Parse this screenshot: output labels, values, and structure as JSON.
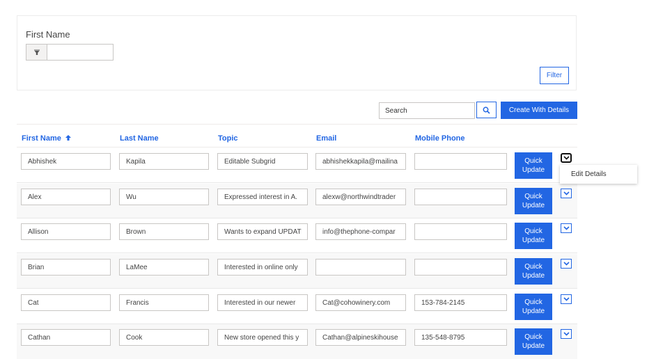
{
  "filter": {
    "label": "First Name",
    "value": "",
    "filter_button": "Filter"
  },
  "toolbar": {
    "search_placeholder": "Search",
    "create_button": "Create With Details"
  },
  "columns": [
    "First Name",
    "Last Name",
    "Topic",
    "Email",
    "Mobile Phone"
  ],
  "sort": {
    "column": "First Name",
    "direction": "ascending"
  },
  "rows": [
    {
      "first": "Abhishek",
      "last": "Kapila",
      "topic": "Editable Subgrid",
      "email": "abhishekkapila@mailina",
      "phone": "",
      "button": "Quick Update"
    },
    {
      "first": "Alex",
      "last": "Wu",
      "topic": "Expressed interest in A.",
      "email": "alexw@northwindtrader",
      "phone": "",
      "button": "Quick Update"
    },
    {
      "first": "Allison",
      "last": "Brown",
      "topic": "Wants to expand UPDAT",
      "email": "info@thephone-compar",
      "phone": "",
      "button": "Quick Update"
    },
    {
      "first": "Brian",
      "last": "LaMee",
      "topic": "Interested in online only",
      "email": "",
      "phone": "",
      "button": "Quick Update"
    },
    {
      "first": "Cat",
      "last": "Francis",
      "topic": "Interested in our newer",
      "email": "Cat@cohowinery.com",
      "phone": "153-784-2145",
      "button": "Quick Update"
    },
    {
      "first": "Cathan",
      "last": "Cook",
      "topic": "New store opened this y",
      "email": "Cathan@alpineskihouse",
      "phone": "135-548-8795",
      "button": "Quick Update"
    }
  ],
  "context_menu": {
    "items": [
      "Edit Details"
    ]
  },
  "colors": {
    "accent": "#2266e3"
  },
  "icons": {
    "filter": "funnel-icon",
    "search": "search-icon",
    "row_menu": "chevron-down-icon",
    "sort": "arrow-up-icon"
  }
}
